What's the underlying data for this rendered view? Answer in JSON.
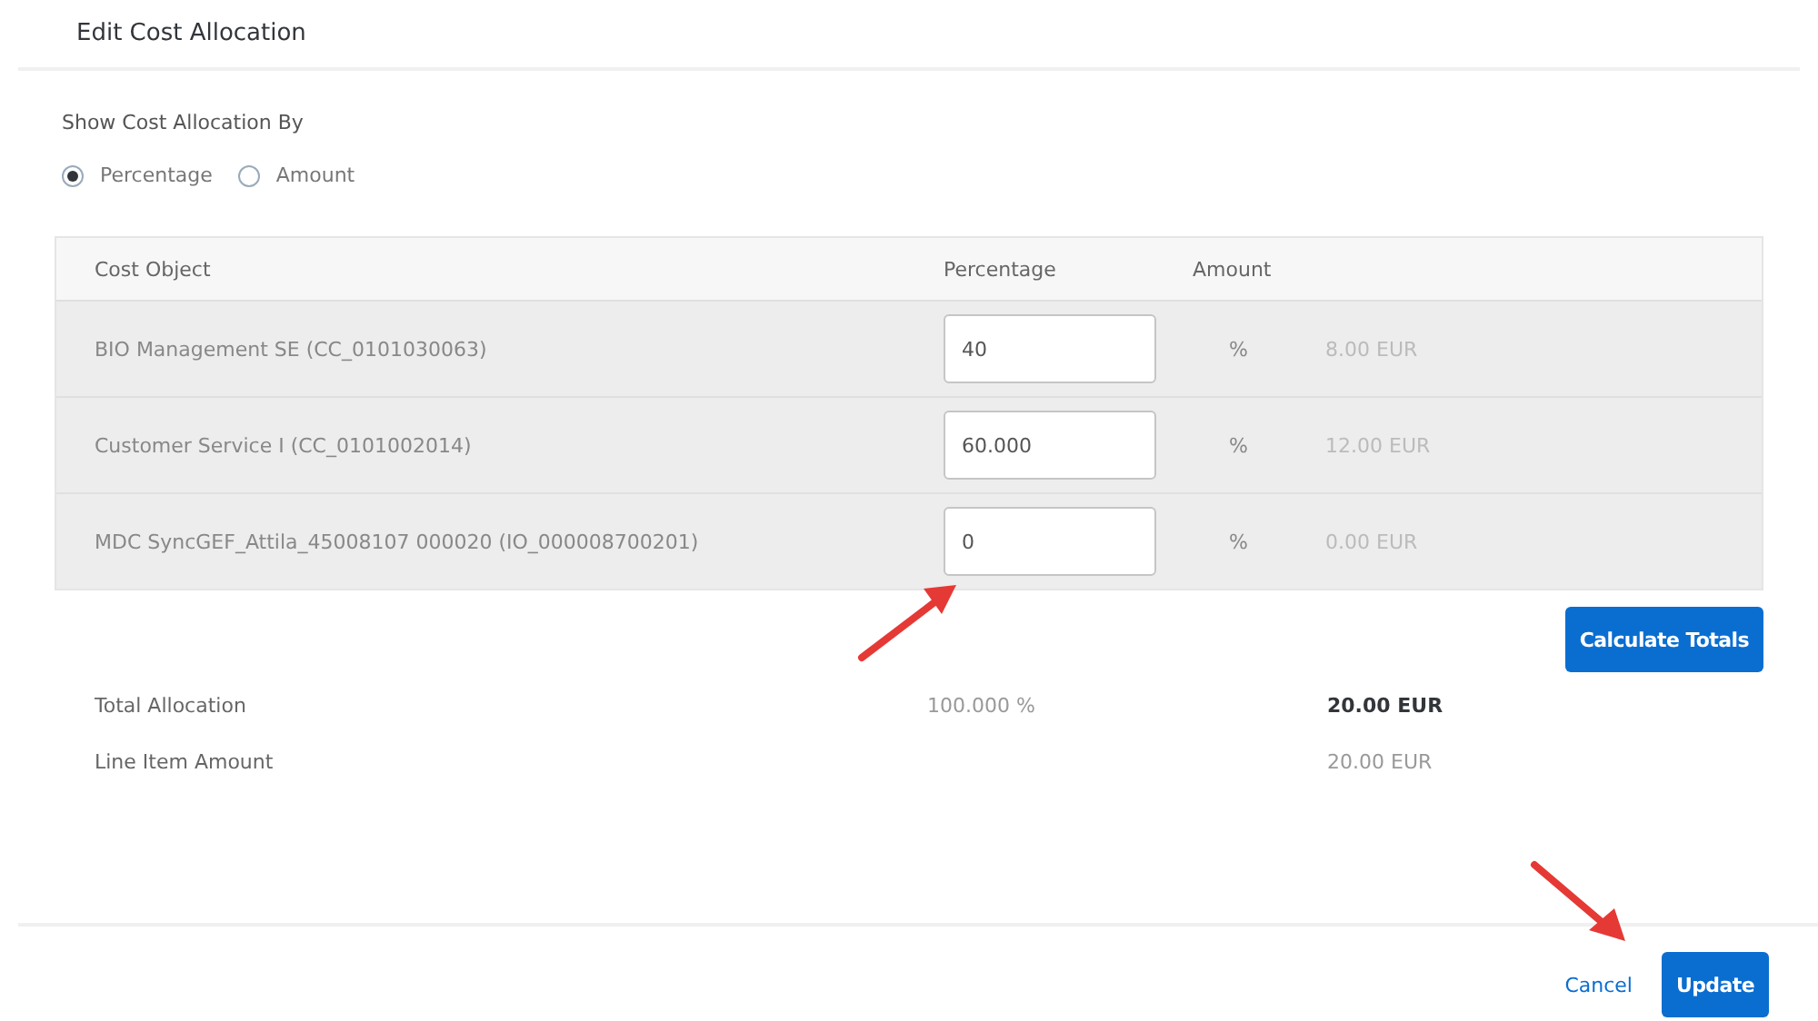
{
  "dialog": {
    "title": "Edit Cost Allocation"
  },
  "show_by": {
    "label": "Show Cost Allocation By",
    "options": [
      {
        "label": "Percentage",
        "selected": true
      },
      {
        "label": "Amount",
        "selected": false
      }
    ]
  },
  "table": {
    "columns": [
      "Cost Object",
      "Percentage",
      "Amount"
    ],
    "rows": [
      {
        "cost_object": "BIO Management SE (CC_0101030063)",
        "percentage": "40",
        "unit": "%",
        "amount": "8.00 EUR"
      },
      {
        "cost_object": "Customer Service I (CC_0101002014)",
        "percentage": "60.000",
        "unit": "%",
        "amount": "12.00 EUR"
      },
      {
        "cost_object": "MDC SyncGEF_Attila_45008107 000020 (IO_000008700201)",
        "percentage": "0",
        "unit": "%",
        "amount": "0.00 EUR"
      }
    ]
  },
  "calculate_button": "Calculate Totals",
  "totals": [
    {
      "label": "Total Allocation",
      "percentage": "100.000 %",
      "amount": "20.00 EUR",
      "emphasized": true
    },
    {
      "label": "Line Item Amount",
      "amount": "20.00 EUR",
      "emphasized": false
    }
  ],
  "footer": {
    "buttons": [
      {
        "label": "Cancel",
        "kind": "link"
      },
      {
        "label": "Update",
        "kind": "primary"
      }
    ]
  }
}
